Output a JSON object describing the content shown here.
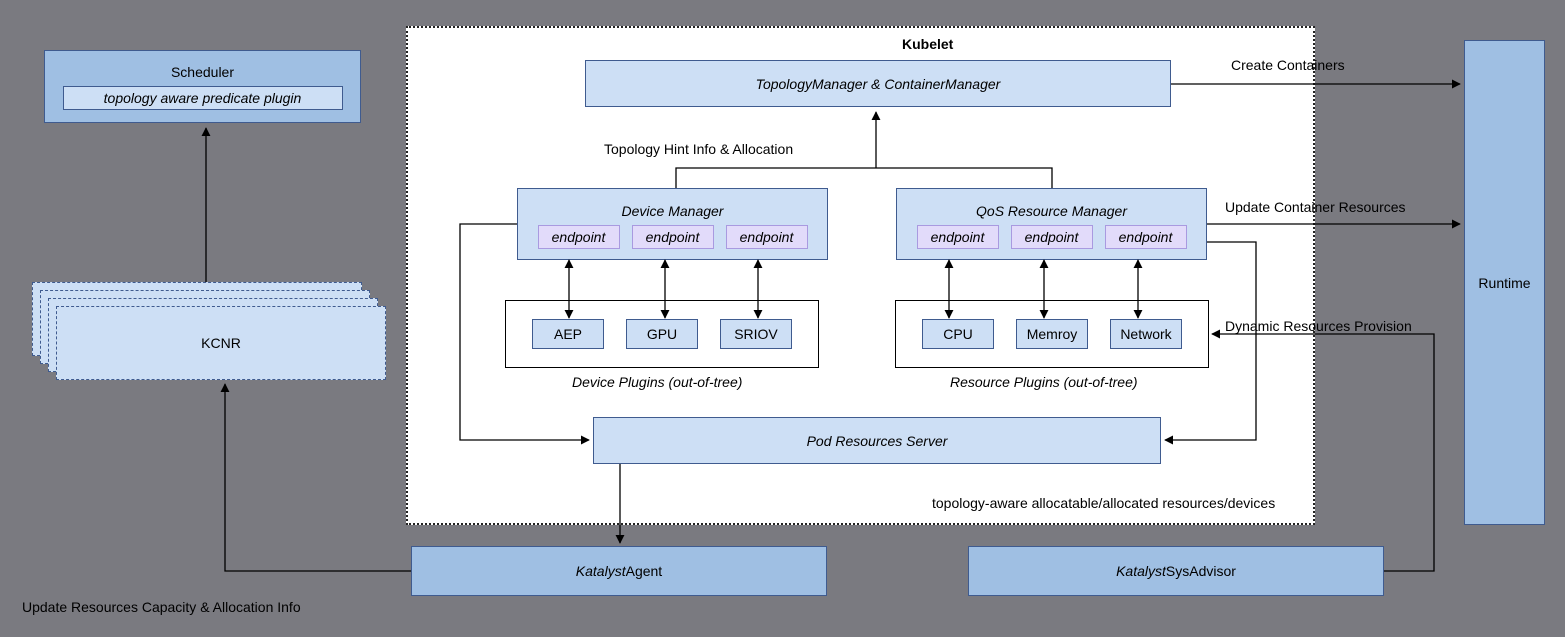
{
  "scheduler": {
    "title": "Scheduler",
    "plugin": "topology aware predicate plugin"
  },
  "kcnr": {
    "title": "KCNR"
  },
  "kubelet": {
    "title": "Kubelet",
    "topology_manager": "TopologyManager & ContainerManager",
    "hint_label": "Topology Hint Info & Allocation",
    "device_manager": {
      "title": "Device Manager",
      "endpoint_label": "endpoint",
      "plugins_label": "Device Plugins (out-of-tree)",
      "plugins": {
        "a": "AEP",
        "b": "GPU",
        "c": "SRIOV"
      }
    },
    "qos_manager": {
      "title": "QoS Resource Manager",
      "endpoint_label": "endpoint",
      "plugins_label": "Resource Plugins (out-of-tree)",
      "plugins": {
        "a": "CPU",
        "b": "Memroy",
        "c": "Network"
      }
    },
    "pod_resources_server": "Pod Resources Server",
    "topo_aware_label": "topology-aware allocatable/allocated resources/devices"
  },
  "runtime": {
    "title": "Runtime"
  },
  "katalyst_agent": {
    "label_prefix": "Katalyst",
    "label_rest": " Agent"
  },
  "sysadvisor": {
    "label_prefix": "Katalyst",
    "label_rest": " SysAdvisor"
  },
  "arrows": {
    "create_containers": "Create Containers",
    "update_resources": "Update Container Resources",
    "dynamic_provision": "Dynamic Resources Provision",
    "update_capacity": "Update Resources Capacity & Allocation Info"
  }
}
